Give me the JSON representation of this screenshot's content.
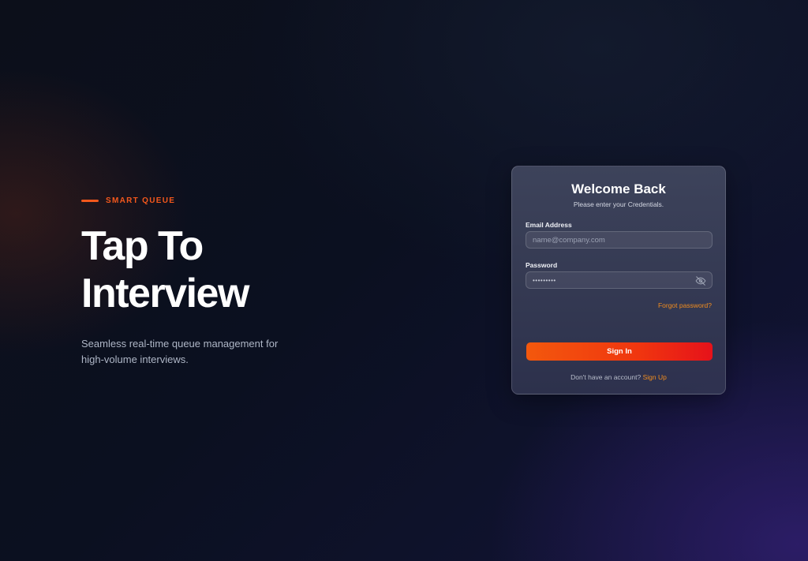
{
  "hero": {
    "eyebrow": "SMART QUEUE",
    "title_line1": "Tap To",
    "title_line2": "Interview",
    "subtitle": "Seamless real-time queue management for high-volume interviews."
  },
  "login": {
    "title": "Welcome Back",
    "subtitle": "Please enter your Credentials.",
    "email": {
      "label": "Email Address",
      "placeholder": "name@company.com",
      "value": ""
    },
    "password": {
      "label": "Password",
      "value": "password1",
      "toggle_icon": "eye-off-icon"
    },
    "forgot_label": "Forgot password?",
    "submit_label": "Sign In",
    "signup_prompt": "Don't have an account?",
    "signup_label": "Sign Up"
  },
  "colors": {
    "accent": "#f4581c",
    "link": "#f28d1e",
    "button_start": "#f3580d",
    "button_end": "#e6121a",
    "background": "#0b1020"
  }
}
